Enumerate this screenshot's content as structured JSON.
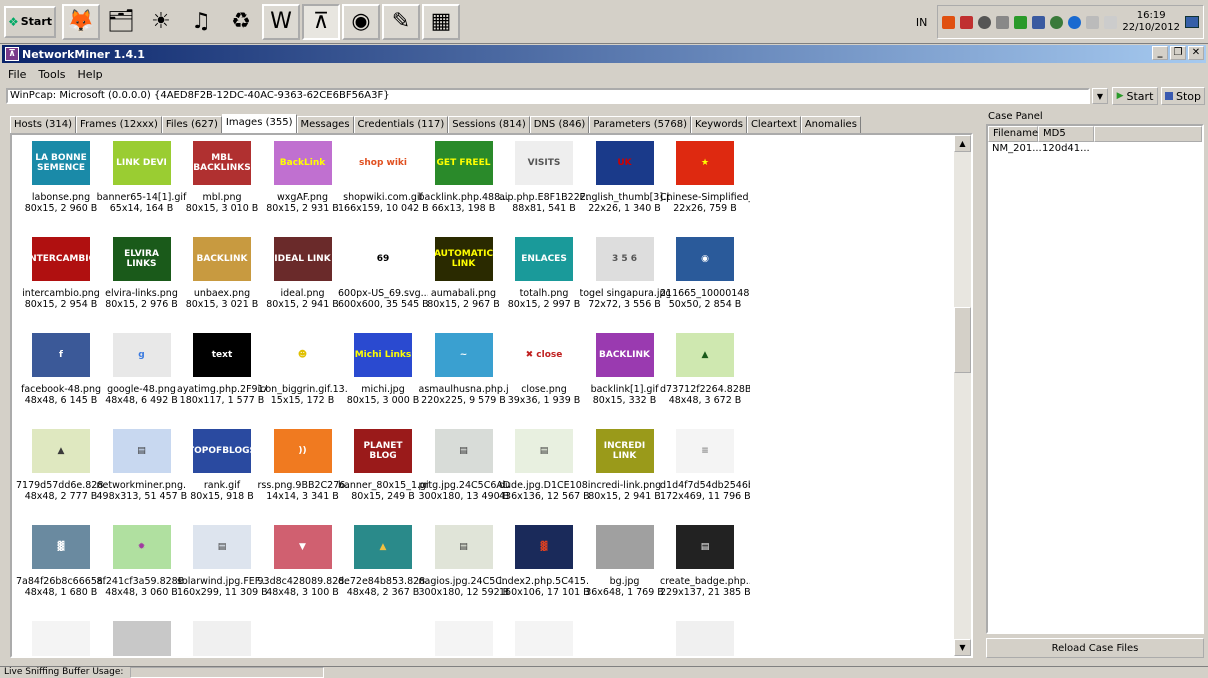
{
  "taskbar": {
    "start_label": "Start",
    "apps": [
      {
        "icon": "firefox-icon",
        "glyph": "🦊",
        "state": "boxed"
      },
      {
        "icon": "folder-icon",
        "glyph": "🗂",
        "state": "normal"
      },
      {
        "icon": "sun-icon",
        "glyph": "☀",
        "state": "normal"
      },
      {
        "icon": "music-icon",
        "glyph": "♫",
        "state": "normal"
      },
      {
        "icon": "sync-icon",
        "glyph": "♻",
        "state": "normal"
      },
      {
        "icon": "word-icon",
        "glyph": "W",
        "state": "boxed"
      },
      {
        "icon": "networkminer-icon",
        "glyph": "⊼",
        "state": "active"
      },
      {
        "icon": "eye-icon",
        "glyph": "◉",
        "state": "boxed"
      },
      {
        "icon": "paint-icon",
        "glyph": "✎",
        "state": "boxed"
      },
      {
        "icon": "calculator-icon",
        "glyph": "▦",
        "state": "boxed"
      }
    ],
    "lang": "IN",
    "time": "16:19",
    "date": "22/10/2012"
  },
  "window": {
    "title": "NetworkMiner 1.4.1"
  },
  "menu": [
    "File",
    "Tools",
    "Help"
  ],
  "adapter": "WinPcap: Microsoft (0.0.0.0) {4AED8F2B-12DC-40AC-9363-62CE6BF56A3F}",
  "buttons": {
    "start": "Start",
    "stop": "Stop"
  },
  "tabs": [
    {
      "label": "Hosts (314)",
      "active": false
    },
    {
      "label": "Frames (12xxx)",
      "active": false
    },
    {
      "label": "Files (627)",
      "active": false
    },
    {
      "label": "Images (355)",
      "active": true
    },
    {
      "label": "Messages",
      "active": false
    },
    {
      "label": "Credentials (117)",
      "active": false
    },
    {
      "label": "Sessions (814)",
      "active": false
    },
    {
      "label": "DNS (846)",
      "active": false
    },
    {
      "label": "Parameters (5768)",
      "active": false
    },
    {
      "label": "Keywords",
      "active": false
    },
    {
      "label": "Cleartext",
      "active": false
    },
    {
      "label": "Anomalies",
      "active": false
    }
  ],
  "images": [
    {
      "name": "labonse.png",
      "size": "80x15, 2 960 B",
      "bg": "#1a8aa8",
      "fg": "#fff",
      "text": "LA BONNE SEMENCE"
    },
    {
      "name": "banner65-14[1].gif",
      "size": "65x14, 164 B",
      "bg": "#9acd32",
      "fg": "#fff",
      "text": "LINK DEVI"
    },
    {
      "name": "mbl.png",
      "size": "80x15, 3 010 B",
      "bg": "#b03030",
      "fg": "#fff",
      "text": "MBL BACKLINKS"
    },
    {
      "name": "wxgAF.png",
      "size": "80x15, 2 931 B",
      "bg": "#c070d0",
      "fg": "#ff0",
      "text": "BackLink"
    },
    {
      "name": "shopwiki.com.gif",
      "size": "166x159, 10 042 B",
      "bg": "#fff",
      "fg": "#e05020",
      "text": "shop wiki"
    },
    {
      "name": "backlink.php.488...",
      "size": "66x13, 198 B",
      "bg": "#2a8a2a",
      "fg": "#ff0",
      "text": "GET FREEL"
    },
    {
      "name": "aip.php.E8F1B222...",
      "size": "88x81, 541 B",
      "bg": "#eee",
      "fg": "#555",
      "text": "VISITS"
    },
    {
      "name": "English_thumb[3].png",
      "size": "22x26, 1 340 B",
      "bg": "#1a3a8a",
      "fg": "#c00",
      "text": "UK"
    },
    {
      "name": "Chinese-Simplified_...",
      "size": "22x26, 759 B",
      "bg": "#de2910",
      "fg": "#ff0",
      "text": "★"
    },
    {
      "name": "intercambio.png",
      "size": "80x15, 2 954 B",
      "bg": "#b01010",
      "fg": "#fff",
      "text": "INTERCAMBIO"
    },
    {
      "name": "elvira-links.png",
      "size": "80x15, 2 976 B",
      "bg": "#1a5a1a",
      "fg": "#fff",
      "text": "ELVIRA LINKS"
    },
    {
      "name": "unbaex.png",
      "size": "80x15, 3 021 B",
      "bg": "#c89a40",
      "fg": "#fff",
      "text": "BACKLINK"
    },
    {
      "name": "ideal.png",
      "size": "80x15, 2 941 B",
      "bg": "#6a2a2a",
      "fg": "#fff",
      "text": "IDEAL LINK"
    },
    {
      "name": "600px-US_69.svg....",
      "size": "600x600, 35 545 B",
      "bg": "#fff",
      "fg": "#000",
      "text": "69"
    },
    {
      "name": "aumabali.png",
      "size": "80x15, 2 967 B",
      "bg": "#2a2a00",
      "fg": "#ff0",
      "text": "AUTOMATIC LINK"
    },
    {
      "name": "totalh.png",
      "size": "80x15, 2 997 B",
      "bg": "#1a9a9a",
      "fg": "#fff",
      "text": "ENLACES"
    },
    {
      "name": "togel singapura.jpg",
      "size": "72x72, 3 556 B",
      "bg": "#ddd",
      "fg": "#555",
      "text": "3 5 6"
    },
    {
      "name": "211665_10000148...",
      "size": "50x50, 2 854 B",
      "bg": "#2a5a9a",
      "fg": "#fff",
      "text": "◉"
    },
    {
      "name": "facebook-48.png",
      "size": "48x48, 6 145 B",
      "bg": "#3b5998",
      "fg": "#fff",
      "text": "f"
    },
    {
      "name": "google-48.png",
      "size": "48x48, 6 492 B",
      "bg": "#e8e8e8",
      "fg": "#3a7ae0",
      "text": "g"
    },
    {
      "name": "ayatimg.php.2F91A...",
      "size": "180x117, 1 577 B",
      "bg": "#000",
      "fg": "#fff",
      "text": "text"
    },
    {
      "name": "icon_biggrin.gif.13...",
      "size": "15x15, 172 B",
      "bg": "#fff",
      "fg": "#e0c000",
      "text": "☻"
    },
    {
      "name": "michi.jpg",
      "size": "80x15, 3 000 B",
      "bg": "#2a4ad0",
      "fg": "#ff0",
      "text": "Michi Links"
    },
    {
      "name": "asmaulhusna.php.j...",
      "size": "220x225, 9 579 B",
      "bg": "#3aa0d0",
      "fg": "#fff",
      "text": "~"
    },
    {
      "name": "close.png",
      "size": "39x36, 1 939 B",
      "bg": "#fff",
      "fg": "#c02020",
      "text": "✖ close"
    },
    {
      "name": "backlink[1].gif",
      "size": "80x15, 332 B",
      "bg": "#9a3ab0",
      "fg": "#fff",
      "text": "BACKLINK"
    },
    {
      "name": "d73712f2264.828B...",
      "size": "48x48, 3 672 B",
      "bg": "#cfe8b0",
      "fg": "#1a5a1a",
      "text": "▲"
    },
    {
      "name": "7179d57dd6e.828...",
      "size": "48x48, 2 777 B",
      "bg": "#dfe8c0",
      "fg": "#3a3a3a",
      "text": "▲"
    },
    {
      "name": "networkminer.png...",
      "size": "498x313, 51 457 B",
      "bg": "#c8d8f0",
      "fg": "#333",
      "text": "▤"
    },
    {
      "name": "rank.gif",
      "size": "80x15, 918 B",
      "bg": "#2a4aa0",
      "fg": "#fff",
      "text": "TOPOFBLOGS"
    },
    {
      "name": "rss.png.9BB2C276...",
      "size": "14x14, 3 341 B",
      "bg": "#f07a20",
      "fg": "#fff",
      "text": "))"
    },
    {
      "name": "banner_80x15_1.gif",
      "size": "80x15, 249 B",
      "bg": "#9a1a1a",
      "fg": "#fff",
      "text": "PLANET BLOG"
    },
    {
      "name": "prtg.jpg.24C5C6AD...",
      "size": "300x180, 13 490 B",
      "bg": "#d8dcd8",
      "fg": "#333",
      "text": "▤"
    },
    {
      "name": "dude.jpg.D1CE108...",
      "size": "436x136, 12 567 B",
      "bg": "#e8f0e0",
      "fg": "#333",
      "text": "▤"
    },
    {
      "name": "incredi-link.png",
      "size": "80x15, 2 941 B",
      "bg": "#9a9a1a",
      "fg": "#fff",
      "text": "INCREDI LINK"
    },
    {
      "name": "d1d4f7d54db2546b...",
      "size": "172x469, 11 796 B",
      "bg": "#f4f4f4",
      "fg": "#888",
      "text": "≡"
    },
    {
      "name": "7a84f26b8c6665a...",
      "size": "48x48, 1 680 B",
      "bg": "#6a8aa0",
      "fg": "#fff",
      "text": "▓"
    },
    {
      "name": "8f241cf3a59.828B...",
      "size": "48x48, 3 060 B",
      "bg": "#b0e0a0",
      "fg": "#a03aa0",
      "text": "✹"
    },
    {
      "name": "solarwind.jpg.FEF...",
      "size": "160x299, 11 309 B",
      "bg": "#dde4ee",
      "fg": "#333",
      "text": "▤"
    },
    {
      "name": "93d8c428089.828...",
      "size": "48x48, 3 100 B",
      "bg": "#d06070",
      "fg": "#fff",
      "text": "▼"
    },
    {
      "name": "de72e84b853.828...",
      "size": "48x48, 2 367 B",
      "bg": "#2a8a8a",
      "fg": "#f0c040",
      "text": "▲"
    },
    {
      "name": "nagios.jpg.24C5C...",
      "size": "300x180, 12 592 B",
      "bg": "#e0e4d8",
      "fg": "#333",
      "text": "▤"
    },
    {
      "name": "index2.php.5C415...",
      "size": "160x106, 17 101 B",
      "bg": "#1a2a5a",
      "fg": "#e04020",
      "text": "▓"
    },
    {
      "name": "bg.jpg",
      "size": "36x648, 1 769 B",
      "bg": "#a0a0a0",
      "fg": "#fff",
      "text": ""
    },
    {
      "name": "create_badge.php....",
      "size": "229x137, 21 385 B",
      "bg": "#222",
      "fg": "#fff",
      "text": "▤"
    }
  ],
  "case_panel": {
    "label": "Case Panel",
    "col_filename": "Filename",
    "col_md5": "MD5",
    "rows": [
      {
        "filename": "NM_201...",
        "md5": "120d41..."
      }
    ],
    "reload": "Reload Case Files"
  },
  "status": "Live Sniffing Buffer Usage:"
}
